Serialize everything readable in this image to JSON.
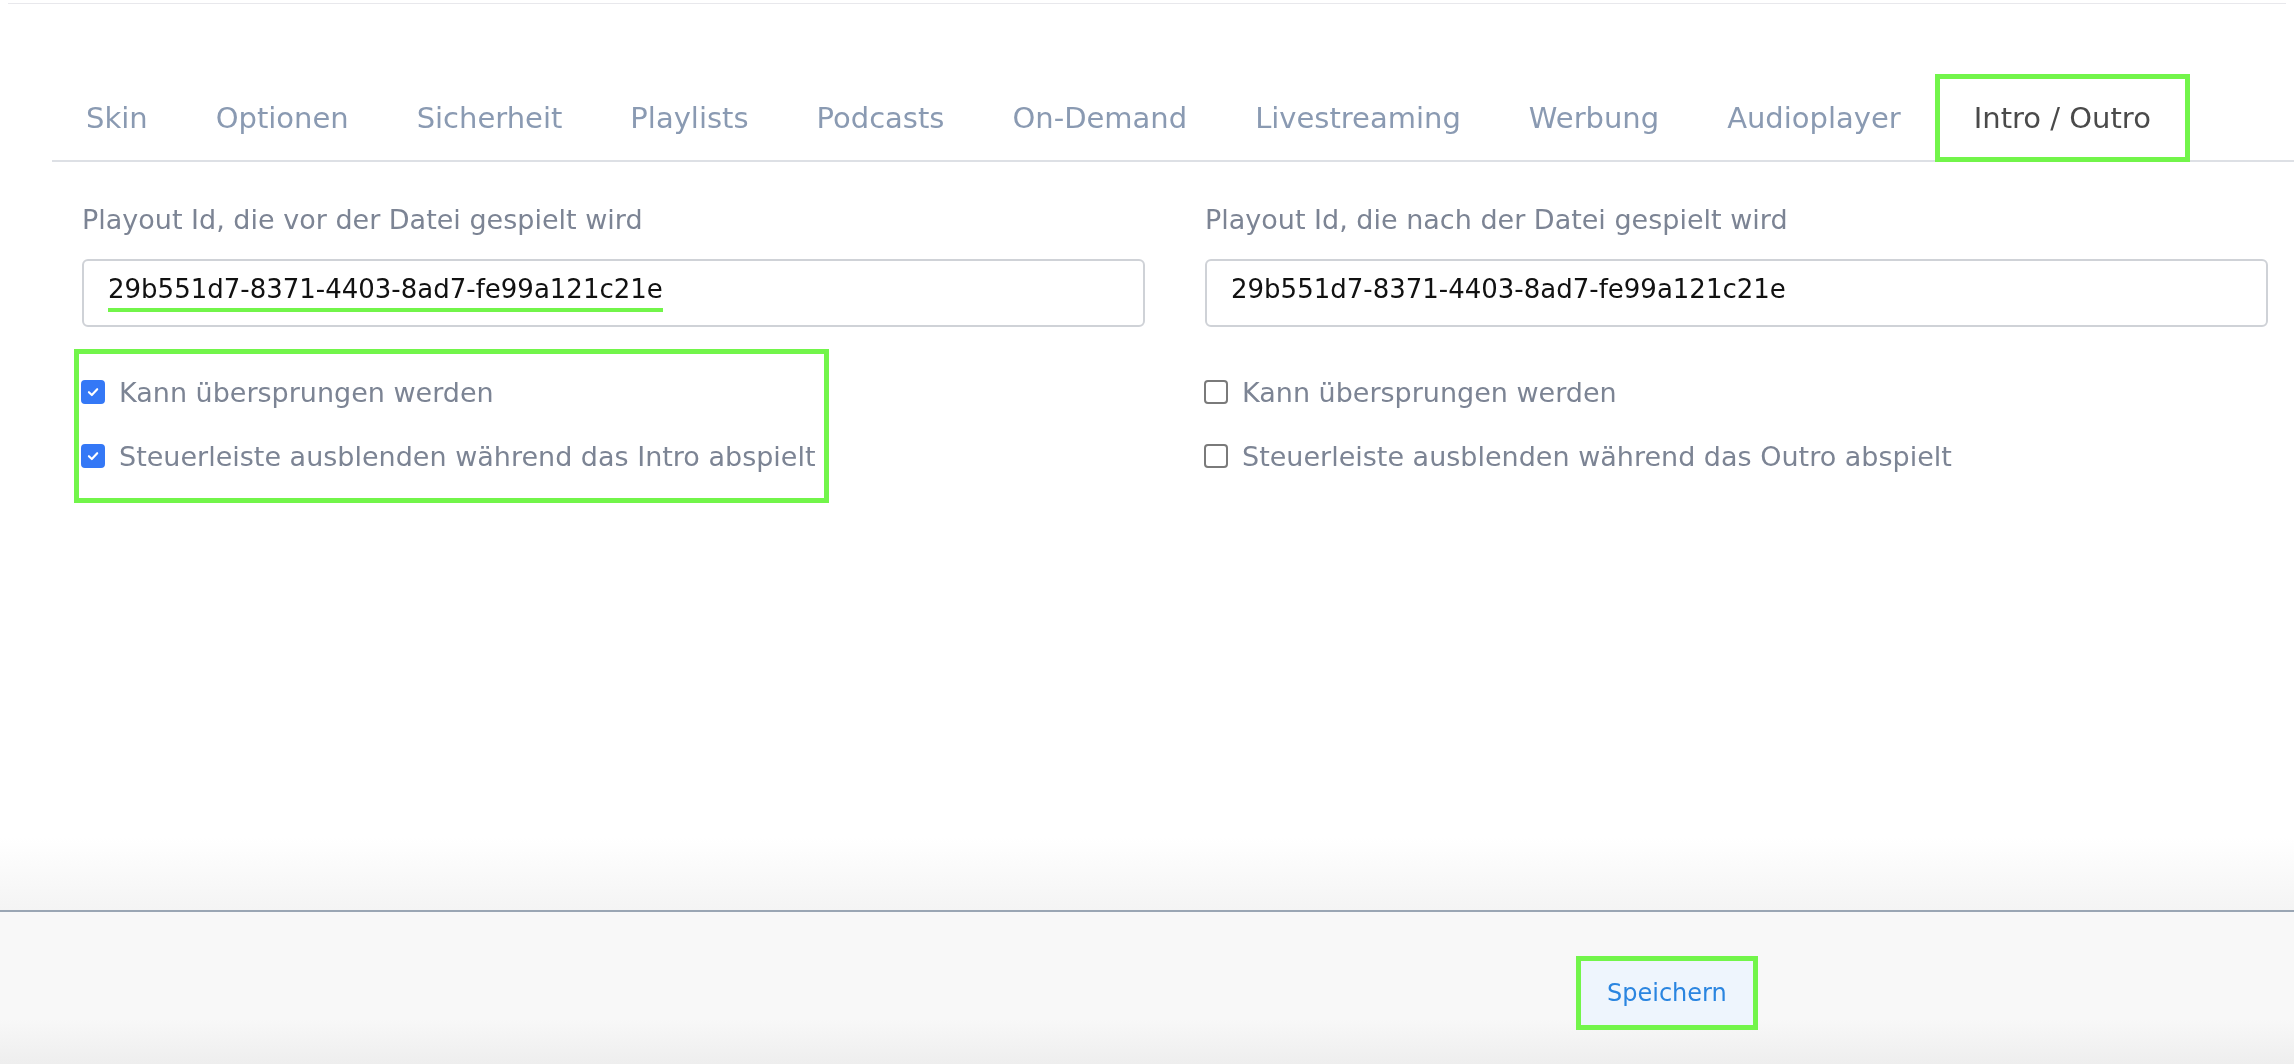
{
  "tabs": [
    {
      "label": "Skin",
      "selected": false,
      "highlighted": false
    },
    {
      "label": "Optionen",
      "selected": false,
      "highlighted": false
    },
    {
      "label": "Sicherheit",
      "selected": false,
      "highlighted": false
    },
    {
      "label": "Playlists",
      "selected": false,
      "highlighted": false
    },
    {
      "label": "Podcasts",
      "selected": false,
      "highlighted": false
    },
    {
      "label": "On-Demand",
      "selected": false,
      "highlighted": false
    },
    {
      "label": "Livestreaming",
      "selected": false,
      "highlighted": false
    },
    {
      "label": "Werbung",
      "selected": false,
      "highlighted": false
    },
    {
      "label": "Audioplayer",
      "selected": false,
      "highlighted": false
    },
    {
      "label": "Intro / Outro",
      "selected": true,
      "highlighted": true
    }
  ],
  "columns": [
    {
      "label": "Playout Id, die vor der Datei gespielt wird",
      "value": "29b551d7-8371-4403-8ad7-fe99a121c21e",
      "value_highlighted": true,
      "options_highlighted": true,
      "options": [
        {
          "label": "Kann übersprungen werden",
          "checked": true
        },
        {
          "label": "Steuerleiste ausblenden während das Intro abspielt",
          "checked": true
        }
      ]
    },
    {
      "label": "Playout Id, die nach der Datei gespielt wird",
      "value": "29b551d7-8371-4403-8ad7-fe99a121c21e",
      "value_highlighted": false,
      "options_highlighted": false,
      "options": [
        {
          "label": "Kann übersprungen werden",
          "checked": false
        },
        {
          "label": "Steuerleiste ausblenden während das Outro abspielt",
          "checked": false
        }
      ]
    }
  ],
  "footer": {
    "save_button": {
      "label": "Speichern",
      "highlighted": true
    }
  }
}
